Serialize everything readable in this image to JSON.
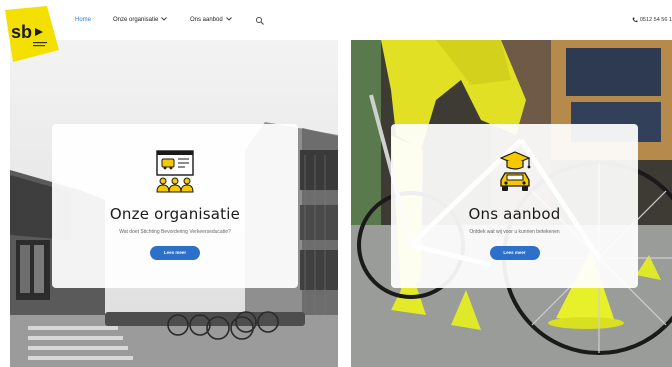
{
  "logo": {
    "text": "sb"
  },
  "nav": {
    "home": "Home",
    "organisatie": "Onze organisatie",
    "aanbod": "Ons aanbod"
  },
  "phone": {
    "text": "0512 54 56 1"
  },
  "cards": [
    {
      "title": "Onze organisatie",
      "subtitle": "Wat doet Stichting Bevordering Verkeerseducatie?",
      "button": "Lees meer"
    },
    {
      "title": "Ons aanbod",
      "subtitle": "Ontdek wat wij voor u kunnen betekenen",
      "button": "Lees meer"
    }
  ],
  "colors": {
    "accent": "#2c70c9",
    "brand_yellow": "#f4e000",
    "icon_yellow": "#f5c800"
  }
}
